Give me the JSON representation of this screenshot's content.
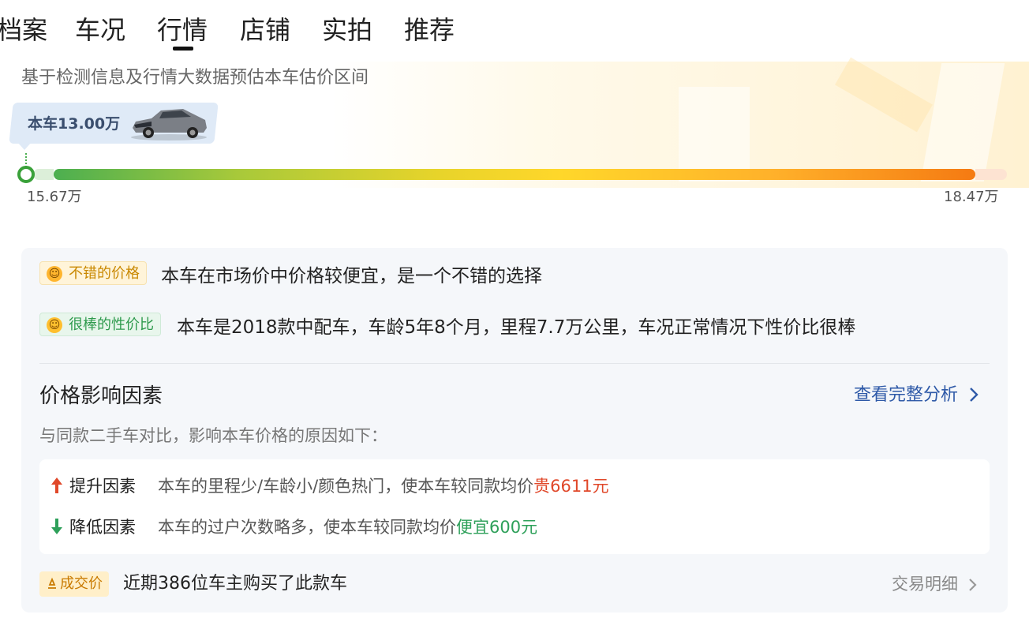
{
  "tabs": [
    {
      "label": "档案"
    },
    {
      "label": "车况"
    },
    {
      "label": "行情"
    },
    {
      "label": "店铺"
    },
    {
      "label": "实拍"
    },
    {
      "label": "推荐"
    }
  ],
  "active_tab": "行情",
  "estimate": {
    "subtitle": "基于检测信息及行情大数据预估本车估价区间",
    "car_price": "本车13.00万",
    "range_low": "15.67万",
    "range_high": "18.47万"
  },
  "assessment": {
    "good_price_tag": "不错的价格",
    "good_price_text": "本车在市场价中价格较便宜，是一个不错的选择",
    "value_tag": "很棒的性价比",
    "value_text": "本车是2018款中配车，车龄5年8个月，里程7.7万公里，车况正常情况下性价比很棒"
  },
  "factors": {
    "title": "价格影响因素",
    "full_analysis_link": "查看完整分析",
    "subtitle": "与同款二手车对比，影响本车价格的原因如下：",
    "up": {
      "label": "提升因素",
      "desc": "本车的里程少/车龄小/颜色热门，使本车较同款均价",
      "value": "贵6611元"
    },
    "down": {
      "label": "降低因素",
      "desc": "本车的过户次数略多，使本车较同款均价",
      "value": "便宜600元"
    }
  },
  "deals": {
    "tag": "成交价",
    "text": "近期386位车主购买了此款车",
    "detail_link": "交易明细"
  },
  "colors": {
    "accent_blue": "#2f5aa8",
    "up_red": "#e0482a",
    "down_green": "#2ea05a",
    "bar_start": "#4caf50",
    "bar_end": "#f57a12"
  }
}
